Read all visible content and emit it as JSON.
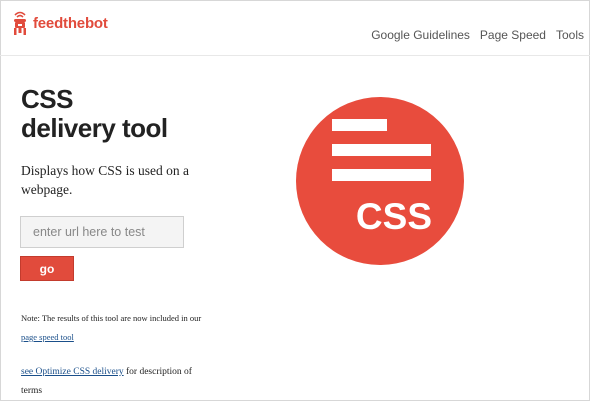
{
  "header": {
    "logo_text": "feedthebot",
    "nav": [
      {
        "label": "Google Guidelines"
      },
      {
        "label": "Page Speed"
      },
      {
        "label": "Tools"
      }
    ]
  },
  "main": {
    "title_line1": "CSS",
    "title_line2": "delivery tool",
    "description": "Displays how CSS is used on a webpage.",
    "url_input": {
      "placeholder": "enter url here to test",
      "value": ""
    },
    "go_label": "go",
    "note": {
      "prefix": "Note: The results of this tool are now included in our ",
      "link_text": "page speed tool"
    },
    "see": {
      "link_text": "see Optimize CSS delivery",
      "suffix": " for description of terms"
    },
    "graphic": {
      "text": "CSS",
      "icon": "css-document-icon",
      "color": "#e84c3d"
    }
  },
  "colors": {
    "brand": "#e14b3c",
    "link": "#1a4f8a",
    "nav_text": "#555555"
  }
}
